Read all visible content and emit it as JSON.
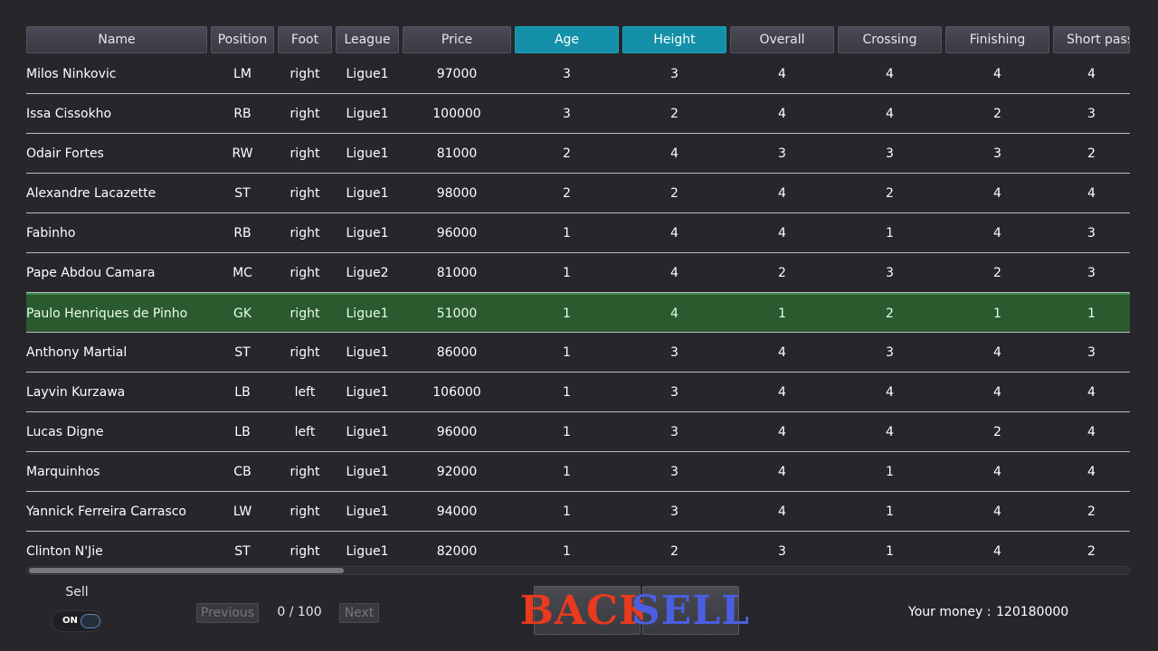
{
  "table": {
    "columns": [
      "Name",
      "Position",
      "Foot",
      "League",
      "Price",
      "Age",
      "Height",
      "Overall",
      "Crossing",
      "Finishing",
      "Short passi"
    ],
    "sorted_columns": [
      "Age",
      "Height"
    ],
    "rows": [
      [
        "Milos Ninkovic",
        "LM",
        "right",
        "Ligue1",
        "97000",
        "3",
        "3",
        "4",
        "4",
        "4",
        "4"
      ],
      [
        "Issa Cissokho",
        "RB",
        "right",
        "Ligue1",
        "100000",
        "3",
        "2",
        "4",
        "4",
        "2",
        "3"
      ],
      [
        "Odair Fortes",
        "RW",
        "right",
        "Ligue1",
        "81000",
        "2",
        "4",
        "3",
        "3",
        "3",
        "2"
      ],
      [
        "Alexandre Lacazette",
        "ST",
        "right",
        "Ligue1",
        "98000",
        "2",
        "2",
        "4",
        "2",
        "4",
        "4"
      ],
      [
        "Fabinho",
        "RB",
        "right",
        "Ligue1",
        "96000",
        "1",
        "4",
        "4",
        "1",
        "4",
        "3"
      ],
      [
        "Pape Abdou Camara",
        "MC",
        "right",
        "Ligue2",
        "81000",
        "1",
        "4",
        "2",
        "3",
        "2",
        "3"
      ],
      [
        "Paulo Henriques de Pinho",
        "GK",
        "right",
        "Ligue1",
        "51000",
        "1",
        "4",
        "1",
        "2",
        "1",
        "1"
      ],
      [
        "Anthony Martial",
        "ST",
        "right",
        "Ligue1",
        "86000",
        "1",
        "3",
        "4",
        "3",
        "4",
        "3"
      ],
      [
        "Layvin Kurzawa",
        "LB",
        "left",
        "Ligue1",
        "106000",
        "1",
        "3",
        "4",
        "4",
        "4",
        "4"
      ],
      [
        "Lucas Digne",
        "LB",
        "left",
        "Ligue1",
        "96000",
        "1",
        "3",
        "4",
        "4",
        "2",
        "4"
      ],
      [
        "Marquinhos",
        "CB",
        "right",
        "Ligue1",
        "92000",
        "1",
        "3",
        "4",
        "1",
        "4",
        "4"
      ],
      [
        "Yannick Ferreira Carrasco",
        "LW",
        "right",
        "Ligue1",
        "94000",
        "1",
        "3",
        "4",
        "1",
        "4",
        "2"
      ],
      [
        "Clinton N'Jie",
        "ST",
        "right",
        "Ligue1",
        "82000",
        "1",
        "2",
        "3",
        "1",
        "4",
        "2"
      ]
    ],
    "selected_row": 6
  },
  "controls": {
    "sell_label": "Sell",
    "toggle_state": "ON",
    "previous_label": "Previous",
    "next_label": "Next",
    "page_count": "0 / 100",
    "back_label": "BACK",
    "sell_button_label": "SELL",
    "money_label": "Your money :",
    "money_value": "120180000"
  },
  "colors": {
    "background": "#26262b",
    "sorted_header": "#1490a8",
    "selected_row": "#2b5a2e",
    "back_text": "#e83a1e",
    "sell_text": "#4a5fe0"
  }
}
